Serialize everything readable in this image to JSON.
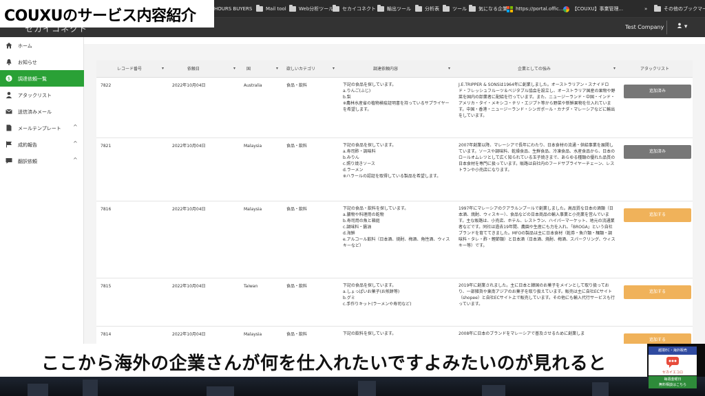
{
  "browser": {
    "bookmarks": [
      {
        "label": "HOURS BUYERS",
        "icon": "folder"
      },
      {
        "label": "Mail tool",
        "icon": "folder"
      },
      {
        "label": "Web分析ツール",
        "icon": "folder"
      },
      {
        "label": "セカイコネクト",
        "icon": "folder"
      },
      {
        "label": "輸出ツール",
        "icon": "folder"
      },
      {
        "label": "分析表",
        "icon": "folder"
      },
      {
        "label": "ツール",
        "icon": "folder"
      },
      {
        "label": "気になる企業",
        "icon": "folder"
      },
      {
        "label": "https://portal.offic...",
        "icon": "ms-logo"
      },
      {
        "label": "【COUXU】事業管理...",
        "icon": "google-drive"
      },
      {
        "label": "その他のブックマーク",
        "icon": "folder"
      }
    ],
    "overflow": "»"
  },
  "banner": {
    "title": "COUXUのサービス内容紹介"
  },
  "header": {
    "app_name": "セカイコネクト",
    "company": "Test Company",
    "user_icon": "user-icon",
    "user_caret": "▾"
  },
  "sidebar": {
    "items": [
      {
        "label": "ホーム",
        "icon": "home-icon"
      },
      {
        "label": "お知らせ",
        "icon": "bell-icon"
      },
      {
        "label": "調達依頼一覧",
        "icon": "dollar-icon",
        "active": true
      },
      {
        "label": "アタックリスト",
        "icon": "user-icon"
      },
      {
        "label": "送信済みメール",
        "icon": "envelope-icon"
      },
      {
        "label": "メールテンプレート",
        "icon": "document-icon",
        "chevron": "^"
      },
      {
        "label": "成約報告",
        "icon": "flag-icon",
        "chevron": "^"
      },
      {
        "label": "翻訳依頼",
        "icon": "chat-icon",
        "chevron": "^"
      }
    ]
  },
  "table": {
    "columns": [
      "レコード番号",
      "依頼日",
      "国",
      "欲しいカテゴリ",
      "調達依頼内容",
      "企業としての強み",
      "アタックリスト"
    ],
    "sort_icon": "▾",
    "rows": [
      {
        "id": "7822",
        "date": "2022年10月04日",
        "country": "Australia",
        "category": "食品・飲料",
        "request": [
          "下記の食品を探しています。",
          "a.りんご(ふじ)",
          "b.梨",
          "※農林水産省の植物検疫証明書を持っているサプライヤーを希望します。"
        ],
        "strength": "J.E.TRIPPER & SONSは1964年に創業しました。オーストラリアン・スナイドロド・フレッシュフルーツ＆ベジタブル協会を設立し、オーストラリア国産の果物や野菜を国内の卸業者に配給を行っています。また、ニュージーランド・中国・インド・アメリカ・タイ・メキシコ・チリ・エジプト等から野菜や新鮮果物を仕入れています。中国・香港・ニュージーランド・シンガポール・カナダ・マレーシアなどに輸出をしています。",
        "action": "追加済み",
        "state": "added"
      },
      {
        "id": "7821",
        "date": "2022年10月04日",
        "country": "Malaysia",
        "category": "食品・飲料",
        "request": [
          "下記の食品を探しています。",
          "a.寿司酢・調味料",
          "b.みりん",
          "c.照り焼きソース",
          "d.ラーメン",
          "※ハラールの認証を取得している製品を希望します。"
        ],
        "strength": "2007年創業以降、マレーシアで長年にわたり、日本食材の流通・供給事業を展開しています。ソースや調味料、乾燥食品、生鮮食品、冷凍食品、水産食品から、日本のロールオムレツとして広く知られている玉子焼きまで、あらゆる種類の優れた品質の日本食材を専門に扱っています。販路は自社内のフードサプライヤーチェーン、レストランや小売店になります。",
        "action": "追加済み",
        "state": "added"
      },
      {
        "id": "7816",
        "date": "2022年10月04日",
        "country": "Malaysia",
        "category": "食品・飲料",
        "request": [
          "下記の食品・飲料を探しています。",
          "a.膿物や料理用の乾物",
          "b.寿司用の魚と箱庭",
          "c.調味料・醤油",
          "d.海鮮",
          "e.アルコール飲料（日本酒、焼酎、梅酒、角性酒、ウィスキーなど）"
        ],
        "strength": "1997年にマレーシアのクアラルンプールで創業しました。高品質な日本の酒類（日本酒、焼酎、ウィスキー）、食品などの日本商品の輸入事業と小売業を営んでいます。主な販路は、小売店、ホテル、レストラン、ハイパーマーケット、地元の流通業者などです。同社は過去19年間、農園や生産にも力を入れ、「BROGA」という自社ブランドを育ててきました。MFOの製品は主に日本食材（乾券・魚介類・麺類・調味料・タレ・酢・鰹節類）と日本酒（日本酒、焼酎、梅酒、スパークリング、ウィスキー等）です。",
        "action": "追加する",
        "state": "add"
      },
      {
        "id": "7815",
        "date": "2022年10月04日",
        "country": "Taiwan",
        "category": "食品・飲料",
        "request": [
          "下記の食品を探しています。",
          "a.しょっぱいお菓子(お煎餅等)",
          "b.グミ",
          "c.手作りキット(ラーメンや寿司など)"
        ],
        "strength": "2019年に創業されました。主に日本と韓国のお菓子をメインとして取り扱っており、一部雑貨や東南アジアのお菓子を取り扱えています。販売は主に自社ECサイト（shopee）と自社ECサイト上で販売しています。その他にも輸入代行サービスも行っています。",
        "action": "追加する",
        "state": "add"
      },
      {
        "id": "7814",
        "date": "2022年10月04日",
        "country": "Malaysia",
        "category": "食品・飲料",
        "request": [
          "下記の飲料を探しています。"
        ],
        "strength": "2008年に日本のブランドをマレーシアで普及させるために創業しま",
        "action": "追加する",
        "state": "add"
      }
    ]
  },
  "caption": {
    "text": "ここから海外の企業さんが何を仕入れたいですよみたいのが見れると"
  },
  "promo": {
    "head": "越境EC・海外販売",
    "name": "セカイエコロ",
    "foot_1": "毎週金曜日",
    "foot_2": "無料相談はこちら"
  }
}
